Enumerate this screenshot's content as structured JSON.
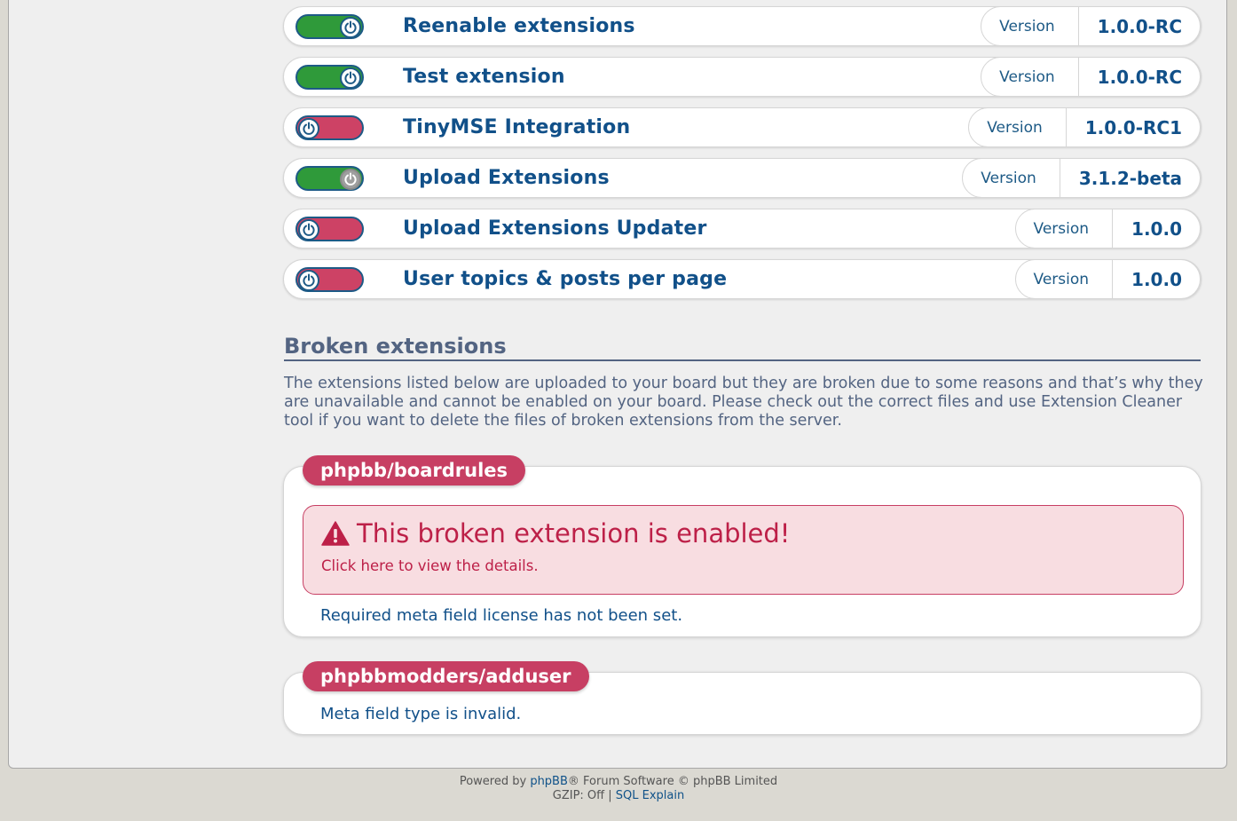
{
  "extensions": [
    {
      "name": "Reenable extensions",
      "enabled": true,
      "version_label": "Version",
      "version": "1.0.0-RC"
    },
    {
      "name": "Test extension",
      "enabled": true,
      "version_label": "Version",
      "version": "1.0.0-RC"
    },
    {
      "name": "TinyMSE Integration",
      "enabled": false,
      "version_label": "Version",
      "version": "1.0.0-RC1"
    },
    {
      "name": "Upload Extensions",
      "enabled": true,
      "version_label": "Version",
      "version": "3.1.2-beta"
    },
    {
      "name": "Upload Extensions Updater",
      "enabled": false,
      "version_label": "Version",
      "version": "1.0.0"
    },
    {
      "name": "User topics & posts per page",
      "enabled": false,
      "version_label": "Version",
      "version": "1.0.0"
    }
  ],
  "broken": {
    "heading": "Broken extensions",
    "description": "The extensions listed below are uploaded to your board but they are broken due to some reasons and that’s why they are unavailable and cannot be enabled on your board. Please check out the correct files and use Extension Cleaner tool if you want to delete the files of broken extensions from the server.",
    "items": [
      {
        "name": "phpbb/boardrules",
        "warning_title": "This broken extension is enabled!",
        "warning_link": "Click here to view the details.",
        "message": "Required meta field license has not been set."
      },
      {
        "name": "phpbbmodders/adduser",
        "message": "Meta field type is invalid."
      }
    ]
  },
  "footer": {
    "powered_prefix": "Powered by ",
    "phpbb_link": "phpBB",
    "powered_suffix": "® Forum Software © phpBB Limited",
    "gzip": "GZIP: Off | ",
    "sql_explain": "SQL Explain"
  },
  "colors": {
    "toggle_on": "#2f9a3a",
    "toggle_off": "#cd4265",
    "brand_blue": "#115089",
    "broken_tag": "#c73f63",
    "warning_bg": "#f8dde1"
  }
}
